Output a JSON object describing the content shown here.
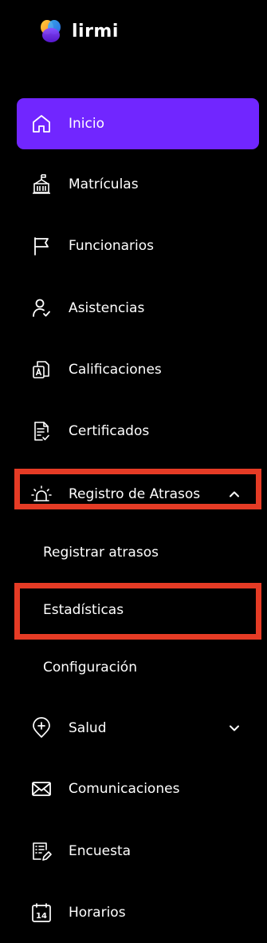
{
  "app": {
    "name": "lirmi",
    "logo_icon": "lirmi-logo-icon"
  },
  "colors": {
    "background": "#000000",
    "accent": "#7126ff",
    "highlight": "#e53b25",
    "text": "#ffffff"
  },
  "nav": {
    "items": [
      {
        "label": "Inicio",
        "icon": "home-icon",
        "active": true
      },
      {
        "label": "Matrículas",
        "icon": "school-building-icon"
      },
      {
        "label": "Funcionarios",
        "icon": "flag-icon"
      },
      {
        "label": "Asistencias",
        "icon": "user-check-icon"
      },
      {
        "label": "Calificaciones",
        "icon": "grade-document-icon"
      },
      {
        "label": "Certificados",
        "icon": "certificate-document-icon"
      },
      {
        "label": "Registro de Atrasos",
        "icon": "alarm-siren-icon",
        "expanded": true,
        "chevron": "chevron-up-icon"
      },
      {
        "label": "Salud",
        "icon": "health-pin-icon",
        "expanded": false,
        "chevron": "chevron-down-icon"
      },
      {
        "label": "Comunicaciones",
        "icon": "mail-icon"
      },
      {
        "label": "Encuesta",
        "icon": "survey-edit-icon"
      },
      {
        "label": "Horarios",
        "icon": "calendar-icon",
        "calendar_day": "14"
      }
    ],
    "atrasos_submenu": [
      {
        "label": "Registrar atrasos"
      },
      {
        "label": "Estadísticas",
        "highlighted": true
      },
      {
        "label": "Configuración"
      }
    ]
  }
}
